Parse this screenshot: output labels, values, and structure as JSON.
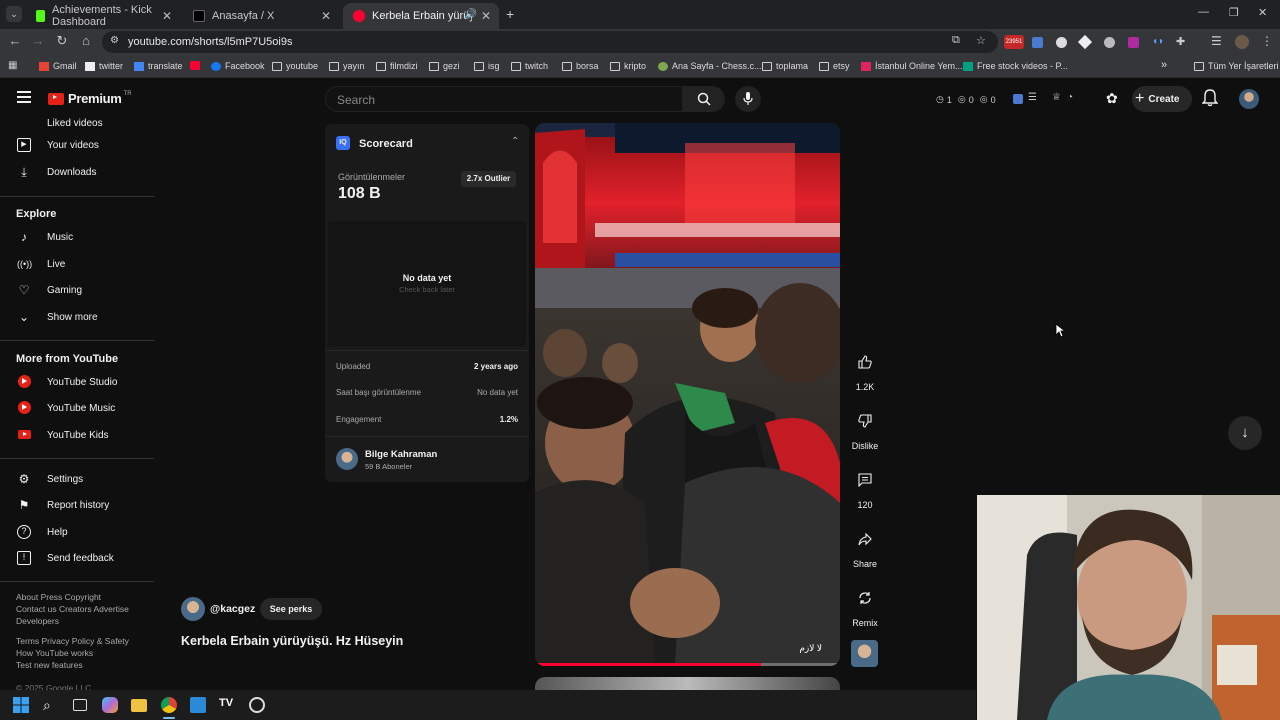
{
  "browser": {
    "tabs": [
      {
        "title": "Achievements - Kick Dashboard",
        "color": "#53fc18"
      },
      {
        "title": "Anasayfa / X",
        "color": "#000000"
      },
      {
        "title": "Kerbela Erbain yürüyüşü. H...",
        "color": "#ff0033"
      }
    ],
    "new_tab": "+",
    "url": "youtube.com/shorts/l5mP7U5oi9s",
    "bookmarks": [
      "Gmail",
      "twitter",
      "translate",
      "",
      "Facebook",
      "youtube",
      "yayın",
      "filmdizi",
      "gezi",
      "isg",
      "twitch",
      "borsa",
      "kripto",
      "Ana Sayfa - Chess.c...",
      "toplama",
      "etsy",
      "İstanbul Online Yem...",
      "Free stock videos - P..."
    ],
    "all_bookmarks": "Tüm Yer İşaretleri",
    "badge": "23951"
  },
  "youtube": {
    "logo_text": "Premium",
    "region": "TR",
    "search_placeholder": "Search",
    "create_label": "Create",
    "header_stats": [
      "1",
      "0",
      "0"
    ]
  },
  "sidebar": {
    "top_items": [
      {
        "label": "Liked videos",
        "icon": "thumb-up-icon"
      },
      {
        "label": "Your videos",
        "icon": "play-icon"
      },
      {
        "label": "Downloads",
        "icon": "download-icon"
      }
    ],
    "explore_title": "Explore",
    "explore_items": [
      {
        "label": "Music",
        "icon": "music-icon"
      },
      {
        "label": "Live",
        "icon": "live-icon"
      },
      {
        "label": "Gaming",
        "icon": "gamepad-icon"
      },
      {
        "label": "Show more",
        "icon": "chevron-down-icon"
      }
    ],
    "more_title": "More from YouTube",
    "more_items": [
      {
        "label": "YouTube Studio"
      },
      {
        "label": "YouTube Music"
      },
      {
        "label": "YouTube Kids"
      }
    ],
    "settings_items": [
      {
        "label": "Settings",
        "icon": "gear-icon"
      },
      {
        "label": "Report history",
        "icon": "flag-icon"
      },
      {
        "label": "Help",
        "icon": "help-icon"
      },
      {
        "label": "Send feedback",
        "icon": "feedback-icon"
      }
    ],
    "footer1": "About  Press  Copyright",
    "footer2": "Contact us  Creators  Advertise",
    "footer3": "Developers",
    "footer4": "Terms  Privacy  Policy & Safety",
    "footer5": "How YouTube works",
    "footer6": "Test new features",
    "footer7": "© 2025 Google LLC"
  },
  "scorecard": {
    "title": "Scorecard",
    "views_label": "Görüntülenmeler",
    "views_value": "108 B",
    "outlier": "2.7x Outlier",
    "no_data": "No data yet",
    "check_back": "Check back later",
    "uploaded_label": "Uploaded",
    "uploaded_value": "2 years ago",
    "hourly_label": "Saat başı görüntülenme",
    "hourly_value": "No data yet",
    "engagement_label": "Engagement",
    "engagement_value": "1.2%",
    "channel_name": "Bilge Kahraman",
    "channel_subs": "59 B Aboneler"
  },
  "video": {
    "channel_handle": "@kacgez",
    "perks_label": "See perks",
    "title": "Kerbela Erbain yürüyüşü. Hz Hüseyin",
    "overlay_text": "لا لازم",
    "progress": 0.74
  },
  "actions": {
    "like_count": "1.2K",
    "dislike_label": "Dislike",
    "comment_count": "120",
    "share_label": "Share",
    "remix_label": "Remix"
  },
  "colors": {
    "bg": "#0f0f0f",
    "accent_red": "#ff0033",
    "panel": "#1a1a1a"
  }
}
